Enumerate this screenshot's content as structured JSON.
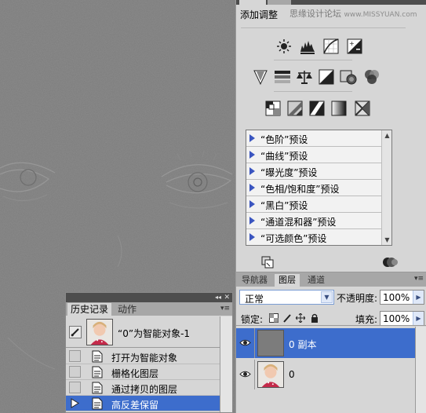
{
  "adjustments": {
    "title": "添加调整",
    "watermark": "思缘设计论坛",
    "watermark_url": "www.MISSYUAN.com",
    "presets": [
      "“色阶”预设",
      "“曲线”预设",
      "“曝光度”预设",
      "“色相/饱和度”预设",
      "“黑白”预设",
      "“通道混和器”预设",
      "“可选颜色”预设"
    ],
    "icon_rows": [
      [
        "brightness-contrast-icon",
        "levels-icon",
        "curves-icon",
        "exposure-icon"
      ],
      [
        "vibrance-icon",
        "hue-saturation-icon",
        "color-balance-icon",
        "black-white-icon",
        "photo-filter-icon",
        "channel-mixer-icon"
      ],
      [
        "invert-icon",
        "posterize-icon",
        "threshold-icon",
        "gradient-map-icon",
        "selective-color-icon"
      ]
    ]
  },
  "layers": {
    "tabs": [
      "导航器",
      "图层",
      "通道"
    ],
    "active_tab": "图层",
    "blend_mode": "正常",
    "opacity_label": "不透明度:",
    "opacity_value": "100%",
    "lock_label": "锁定:",
    "fill_label": "填充:",
    "fill_value": "100%",
    "items": [
      {
        "name": "0 副本",
        "selected": true
      },
      {
        "name": "0",
        "selected": false
      }
    ]
  },
  "history": {
    "tabs": [
      "历史记录",
      "动作"
    ],
    "active_tab": "历史记录",
    "snapshot_label": "“0”为智能对象-1",
    "items": [
      {
        "label": "打开为智能对象",
        "selected": false
      },
      {
        "label": "栅格化图层",
        "selected": false
      },
      {
        "label": "通过拷贝的图层",
        "selected": false
      },
      {
        "label": "高反差保留",
        "selected": true
      }
    ]
  },
  "colors": {
    "selection": "#3d6dcc",
    "panel_bg": "#d6d6d6",
    "canvas_gray": "#7c7c7c"
  }
}
